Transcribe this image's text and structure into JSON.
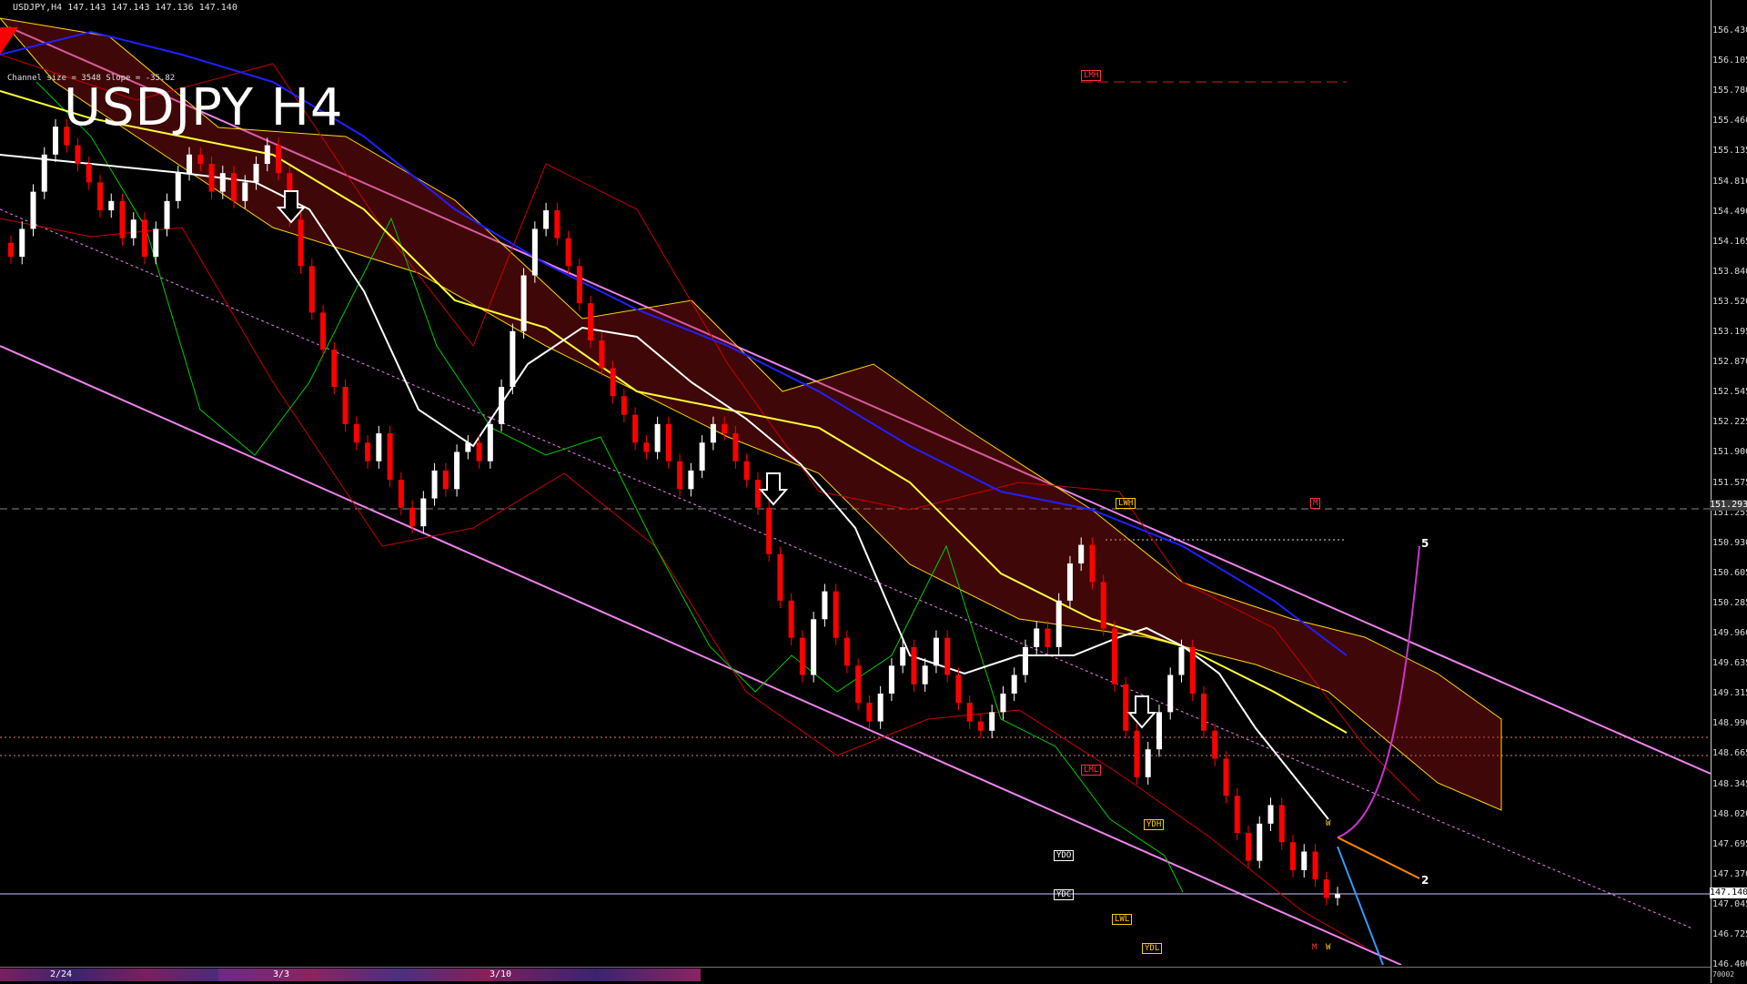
{
  "header": {
    "quote_line": "USDJPY,H4  147.143 147.143 147.136 147.140",
    "channel_info": "Channel size = 3548 Slope = -35.82",
    "big_title": "USDJPY H4"
  },
  "colors": {
    "background": "#000000",
    "bull_candle": "#ffffff",
    "bear_candle": "#ff0000",
    "channel": "#ee82ee",
    "ma_white": "#ffffff",
    "ma_yellow": "#ffff33",
    "ma_blue": "#2020ff",
    "kumo": "#ffd700",
    "chikou": "#00cc00",
    "bollinger": "#cc0000"
  },
  "price_axis": {
    "ticks": [
      "156.430",
      "156.105",
      "155.780",
      "155.460",
      "155.135",
      "154.810",
      "154.490",
      "154.165",
      "153.840",
      "153.520",
      "153.195",
      "152.870",
      "152.545",
      "152.225",
      "151.900",
      "151.575",
      "151.255",
      "150.930",
      "150.605",
      "150.285",
      "149.960",
      "149.635",
      "149.315",
      "148.990",
      "148.665",
      "148.345",
      "148.020",
      "147.695",
      "147.370",
      "147.045",
      "146.725",
      "146.400"
    ],
    "current_price": "147.140",
    "line_price": "151.293"
  },
  "levels": {
    "lmh": "LMH",
    "lwh": "LWH",
    "lml": "LML",
    "ydh": "YDH",
    "ydo": "YDO",
    "ydc": "YDC",
    "lwl": "LWL",
    "ydl": "YDL",
    "m1": "M",
    "m2": "M",
    "ww1": "W",
    "ww2": "W"
  },
  "wave_labels": {
    "five": "5",
    "two": "2"
  },
  "time_axis": {
    "dates": [
      {
        "label": "2/24"
      },
      {
        "label": "3/3"
      },
      {
        "label": "3/10"
      }
    ],
    "corner": "70002"
  },
  "chart_data": {
    "type": "candlestick",
    "symbol": "USDJPY",
    "timeframe": "H4",
    "ylim": [
      146.4,
      156.43
    ],
    "candles_close": [
      154.0,
      154.3,
      154.7,
      155.1,
      155.4,
      155.2,
      155.0,
      154.8,
      154.5,
      154.6,
      154.2,
      154.4,
      154.0,
      154.3,
      154.6,
      154.9,
      155.1,
      155.0,
      154.7,
      154.9,
      154.6,
      154.8,
      155.0,
      155.2,
      154.9,
      154.4,
      153.9,
      153.4,
      153.0,
      152.6,
      152.2,
      152.0,
      151.8,
      152.1,
      151.6,
      151.3,
      151.1,
      151.4,
      151.7,
      151.5,
      151.9,
      152.0,
      151.8,
      152.2,
      152.6,
      153.2,
      153.8,
      154.3,
      154.5,
      154.2,
      153.9,
      153.5,
      153.1,
      152.8,
      152.5,
      152.3,
      152.0,
      151.9,
      152.2,
      151.8,
      151.5,
      151.7,
      152.0,
      152.2,
      152.1,
      151.8,
      151.6,
      151.3,
      150.8,
      150.3,
      149.9,
      149.5,
      150.1,
      150.4,
      149.9,
      149.6,
      149.2,
      149.0,
      149.3,
      149.6,
      149.8,
      149.4,
      149.6,
      149.9,
      149.5,
      149.2,
      149.0,
      148.9,
      149.1,
      149.3,
      149.5,
      149.8,
      150.0,
      149.8,
      150.3,
      150.7,
      150.9,
      150.5,
      150.0,
      149.4,
      148.9,
      148.4,
      148.7,
      149.1,
      149.5,
      149.8,
      149.3,
      148.9,
      148.6,
      148.2,
      147.8,
      147.5,
      147.9,
      148.1,
      147.7,
      147.4,
      147.6,
      147.3,
      147.1,
      147.14
    ]
  }
}
